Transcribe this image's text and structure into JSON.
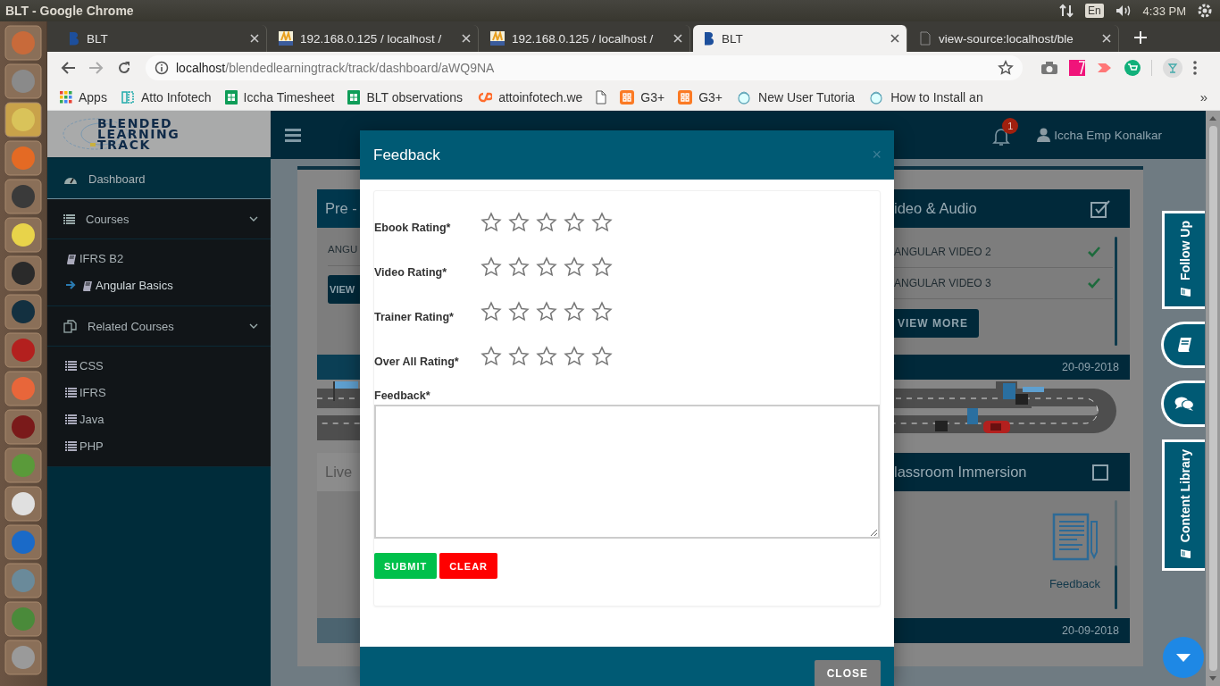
{
  "os_bar": {
    "title": "BLT - Google Chrome",
    "language": "En",
    "time": "4:33 PM"
  },
  "browser": {
    "tabs": [
      {
        "title": "BLT",
        "kind": "blt",
        "selected": false
      },
      {
        "title": "192.168.0.125 / localhost /",
        "kind": "pma",
        "selected": false
      },
      {
        "title": "192.168.0.125 / localhost /",
        "kind": "pma",
        "selected": false
      },
      {
        "title": "BLT",
        "kind": "blt",
        "selected": true
      },
      {
        "title": "view-source:localhost/ble",
        "kind": "page",
        "selected": false
      }
    ],
    "address": {
      "host": "localhost",
      "path": "/blendedlearningtrack/track/dashboard/aWQ9NA"
    },
    "bookmarks": [
      {
        "label": "Apps",
        "kind": "apps"
      },
      {
        "label": "Atto Infotech",
        "kind": "atto"
      },
      {
        "label": "Iccha Timesheet",
        "kind": "sheet"
      },
      {
        "label": "BLT observations",
        "kind": "sheet"
      },
      {
        "label": "attoinfotech.we",
        "kind": "cpanel"
      },
      {
        "kind": "page"
      },
      {
        "label": "G3+",
        "kind": "xampp"
      },
      {
        "label": "G3+",
        "kind": "xampp"
      },
      {
        "label": "New User Tutoria",
        "kind": "tutorial"
      },
      {
        "label": "How to Install an",
        "kind": "tutorial"
      }
    ],
    "bookmarks_more": "»"
  },
  "sidebar": {
    "logo": [
      "BLENDED",
      "LEARNING",
      "TRACK"
    ],
    "items": [
      {
        "label": "Dashboard",
        "kind": "dashboard",
        "selected": true,
        "expanded": false
      },
      {
        "label": "Courses",
        "kind": "courses",
        "selected": false,
        "expanded": true,
        "children": [
          {
            "label": "IFRS B2",
            "kind": "book",
            "selected": false
          },
          {
            "label": "Angular Basics",
            "kind": "book",
            "selected": true
          }
        ]
      },
      {
        "label": "Related Courses",
        "kind": "related",
        "selected": false,
        "expanded": true,
        "children": [
          {
            "label": "CSS",
            "kind": "list",
            "selected": false
          },
          {
            "label": "IFRS",
            "kind": "list",
            "selected": false
          },
          {
            "label": "Java",
            "kind": "list",
            "selected": false
          },
          {
            "label": "PHP",
            "kind": "list",
            "selected": false
          }
        ]
      }
    ]
  },
  "header": {
    "notification_count": "1",
    "user": "Iccha Emp Konalkar"
  },
  "cards_left": [
    {
      "title": "Pre -",
      "disabled": false,
      "items": [
        "ANGU"
      ],
      "button": "VIEW"
    },
    {
      "title": "Live",
      "disabled": true
    }
  ],
  "cards_right": [
    {
      "title": "ideo & Audio",
      "kind": "list",
      "checked": true,
      "items": [
        {
          "label": "ANGULAR VIDEO 2",
          "done": true
        },
        {
          "label": "ANGULAR VIDEO 3",
          "done": true
        }
      ],
      "button": "VIEW MORE",
      "date": "20-09-2018"
    },
    {
      "title": "lassroom Immersion",
      "kind": "feedback",
      "checked": false,
      "link": "Feedback",
      "date": "20-09-2018"
    }
  ],
  "side_tabs": [
    {
      "kind": "tab",
      "label": "Follow Up"
    },
    {
      "kind": "book"
    },
    {
      "kind": "chat"
    },
    {
      "kind": "tab",
      "label": "Content Library"
    }
  ],
  "modal": {
    "title": "Feedback",
    "close": "×",
    "ratings": [
      {
        "label": "Ebook Rating*",
        "stars": 0
      },
      {
        "label": "Video Rating*",
        "stars": 0
      },
      {
        "label": "Trainer Rating*",
        "stars": 0
      },
      {
        "label": "Over All Rating*",
        "stars": 0
      }
    ],
    "feedback_label": "Feedback*",
    "buttons": [
      {
        "label": "SUBMIT",
        "kind": "submit"
      },
      {
        "label": "CLEAR",
        "kind": "clear"
      }
    ],
    "footer_button": "CLOSE"
  }
}
